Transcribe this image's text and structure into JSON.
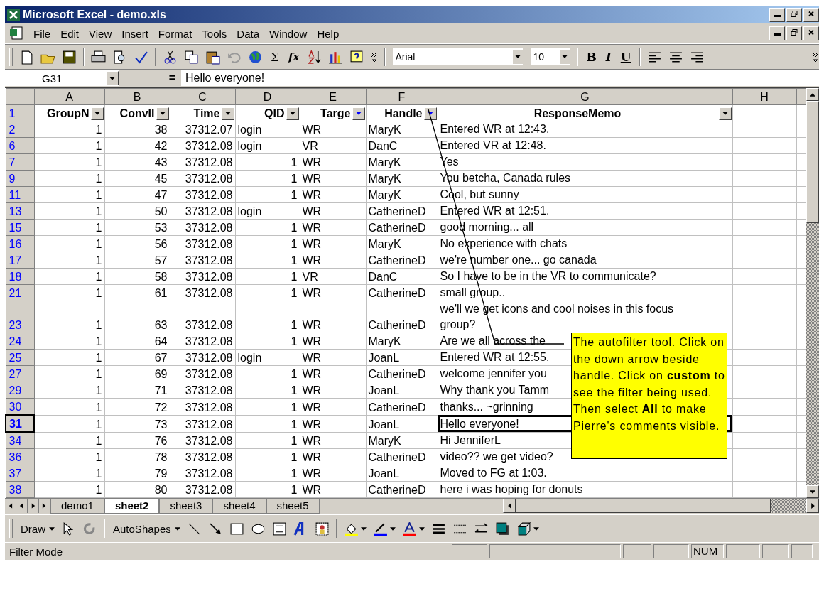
{
  "window": {
    "title": "Microsoft Excel - demo.xls"
  },
  "menu": [
    "File",
    "Edit",
    "View",
    "Insert",
    "Format",
    "Tools",
    "Data",
    "Window",
    "Help"
  ],
  "toolbar": {
    "sum": "Σ",
    "function": "fx",
    "font": "Arial",
    "size": "10",
    "bold": "B",
    "italic": "I",
    "underline": "U"
  },
  "formula_bar": {
    "cell": "G31",
    "equals": "=",
    "value": "Hello everyone!"
  },
  "columns": [
    "A",
    "B",
    "C",
    "D",
    "E",
    "F",
    "G",
    "H"
  ],
  "header_row": {
    "row": "1",
    "cells": [
      {
        "label": "GroupN",
        "filtered": false
      },
      {
        "label": "ConvII",
        "filtered": false
      },
      {
        "label": "Time",
        "filtered": false
      },
      {
        "label": "QID",
        "filtered": false
      },
      {
        "label": "Targe",
        "filtered": true
      },
      {
        "label": "Handle",
        "filtered": true
      },
      {
        "label": "ResponseMemo",
        "filtered": false
      }
    ]
  },
  "rows": [
    {
      "row": "2",
      "group": "1",
      "conv": "38",
      "time": "37312.07",
      "qid": "login",
      "target": "WR",
      "handle": "MaryK",
      "memo": "Entered WR at  12:43.",
      "selected": false
    },
    {
      "row": "6",
      "group": "1",
      "conv": "42",
      "time": "37312.08",
      "qid": "login",
      "target": "VR",
      "handle": "DanC",
      "memo": "Entered VR at  12:48.",
      "selected": false
    },
    {
      "row": "7",
      "group": "1",
      "conv": "43",
      "time": "37312.08",
      "qid": "1",
      "target": "WR",
      "handle": "MaryK",
      "memo": "Yes",
      "selected": false
    },
    {
      "row": "9",
      "group": "1",
      "conv": "45",
      "time": "37312.08",
      "qid": "1",
      "target": "WR",
      "handle": "MaryK",
      "memo": "You betcha, Canada rules",
      "selected": false
    },
    {
      "row": "11",
      "group": "1",
      "conv": "47",
      "time": "37312.08",
      "qid": "1",
      "target": "WR",
      "handle": "MaryK",
      "memo": "Cool, but sunny",
      "selected": false
    },
    {
      "row": "13",
      "group": "1",
      "conv": "50",
      "time": "37312.08",
      "qid": "login",
      "target": "WR",
      "handle": "CatherineD",
      "memo": "Entered WR at  12:51.",
      "selected": false
    },
    {
      "row": "15",
      "group": "1",
      "conv": "53",
      "time": "37312.08",
      "qid": "1",
      "target": "WR",
      "handle": "CatherineD",
      "memo": "good morning... all",
      "selected": false
    },
    {
      "row": "16",
      "group": "1",
      "conv": "56",
      "time": "37312.08",
      "qid": "1",
      "target": "WR",
      "handle": "MaryK",
      "memo": "No experience with chats",
      "selected": false
    },
    {
      "row": "17",
      "group": "1",
      "conv": "57",
      "time": "37312.08",
      "qid": "1",
      "target": "WR",
      "handle": "CatherineD",
      "memo": "we're number one... go canada",
      "selected": false
    },
    {
      "row": "18",
      "group": "1",
      "conv": "58",
      "time": "37312.08",
      "qid": "1",
      "target": "VR",
      "handle": "DanC",
      "memo": "So I have to be in the VR to communicate?",
      "selected": false
    },
    {
      "row": "21",
      "group": "1",
      "conv": "61",
      "time": "37312.08",
      "qid": "1",
      "target": "WR",
      "handle": "CatherineD",
      "memo": "small group..",
      "selected": false
    },
    {
      "row": "23",
      "group": "1",
      "conv": "63",
      "time": "37312.08",
      "qid": "1",
      "target": "WR",
      "handle": "CatherineD",
      "memo": "we'll we get icons and cool noises in this focus group?",
      "selected": false
    },
    {
      "row": "24",
      "group": "1",
      "conv": "64",
      "time": "37312.08",
      "qid": "1",
      "target": "WR",
      "handle": "MaryK",
      "memo": "Are we all across the",
      "selected": false
    },
    {
      "row": "25",
      "group": "1",
      "conv": "67",
      "time": "37312.08",
      "qid": "login",
      "target": "WR",
      "handle": "JoanL",
      "memo": "Entered WR at  12:55.",
      "selected": false
    },
    {
      "row": "27",
      "group": "1",
      "conv": "69",
      "time": "37312.08",
      "qid": "1",
      "target": "WR",
      "handle": "CatherineD",
      "memo": "welcome jennifer you",
      "selected": false
    },
    {
      "row": "29",
      "group": "1",
      "conv": "71",
      "time": "37312.08",
      "qid": "1",
      "target": "WR",
      "handle": "JoanL",
      "memo": "Why thank you Tamm",
      "selected": false
    },
    {
      "row": "30",
      "group": "1",
      "conv": "72",
      "time": "37312.08",
      "qid": "1",
      "target": "WR",
      "handle": "CatherineD",
      "memo": "thanks... ~grinning",
      "selected": false
    },
    {
      "row": "31",
      "group": "1",
      "conv": "73",
      "time": "37312.08",
      "qid": "1",
      "target": "WR",
      "handle": "JoanL",
      "memo": "Hello everyone!",
      "selected": true
    },
    {
      "row": "34",
      "group": "1",
      "conv": "76",
      "time": "37312.08",
      "qid": "1",
      "target": "WR",
      "handle": "MaryK",
      "memo": "Hi JenniferL",
      "selected": false
    },
    {
      "row": "36",
      "group": "1",
      "conv": "78",
      "time": "37312.08",
      "qid": "1",
      "target": "WR",
      "handle": "CatherineD",
      "memo": "video?? we get video?",
      "selected": false
    },
    {
      "row": "37",
      "group": "1",
      "conv": "79",
      "time": "37312.08",
      "qid": "1",
      "target": "WR",
      "handle": "JoanL",
      "memo": "Moved to FG at  1:03.",
      "selected": false
    },
    {
      "row": "38",
      "group": "1",
      "conv": "80",
      "time": "37312.08",
      "qid": "1",
      "target": "WR",
      "handle": "CatherineD",
      "memo": "here i was hoping for donuts",
      "selected": false
    }
  ],
  "note": "The autofilter tool. Click on the down arrow beside handle. Click on **custom** to see the filter being used. Then select **All** to make Pierre's comments visible.",
  "sheet_tabs": [
    {
      "label": "demo1",
      "selected": false
    },
    {
      "label": "sheet2",
      "selected": true
    },
    {
      "label": "sheet3",
      "selected": false
    },
    {
      "label": "sheet4",
      "selected": false
    },
    {
      "label": "sheet5",
      "selected": false
    }
  ],
  "drawing_toolbar": {
    "draw": "Draw",
    "autoshapes": "AutoShapes"
  },
  "status_bar": {
    "mode": "Filter Mode",
    "num": "NUM"
  }
}
